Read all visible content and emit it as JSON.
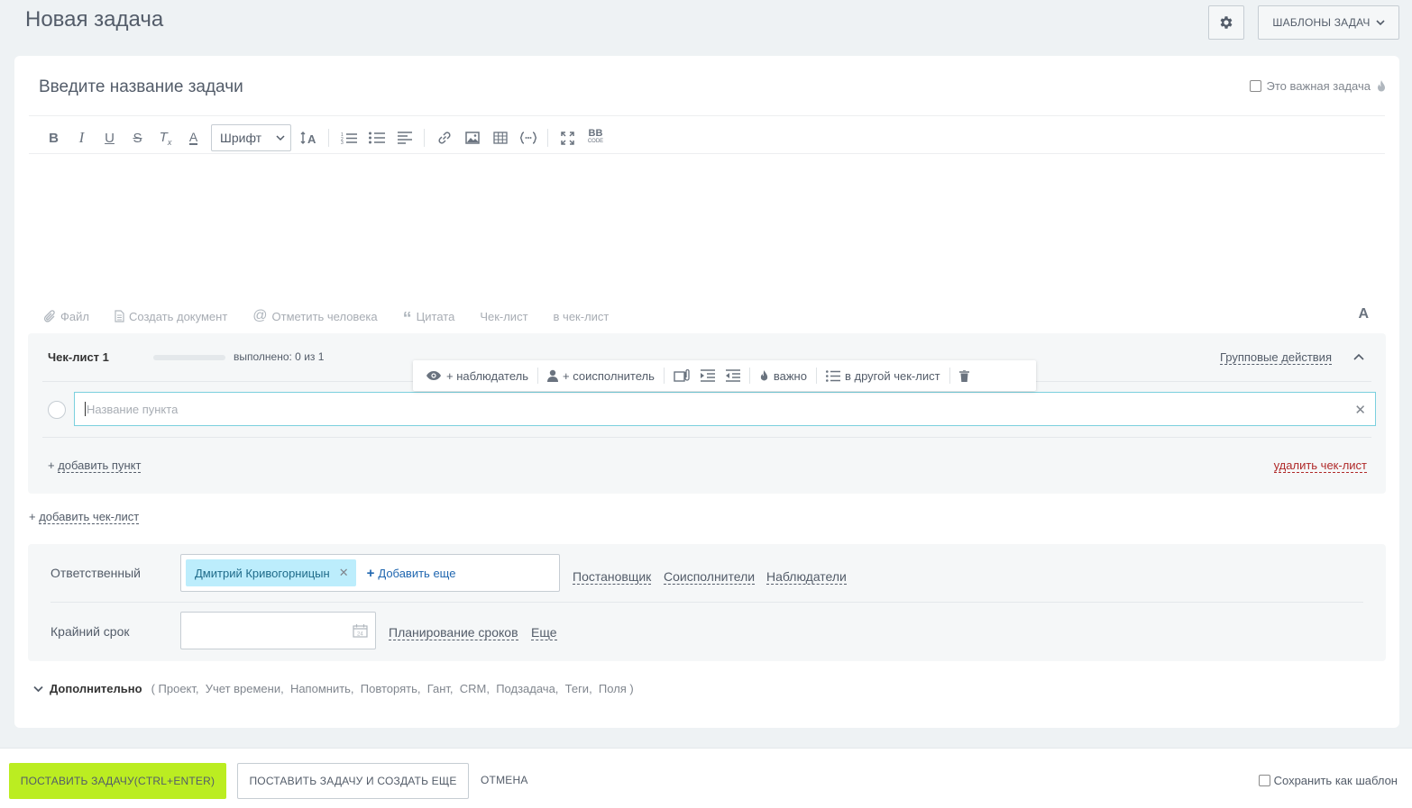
{
  "header": {
    "title": "Новая задача",
    "templates_label": "ШАБЛОНЫ ЗАДАЧ"
  },
  "task": {
    "title_placeholder": "Введите название задачи",
    "important_label": "Это важная задача"
  },
  "toolbar": {
    "font_label": "Шрифт",
    "bbcode_label": "BB",
    "bbcode_sub": "CODE"
  },
  "attach": {
    "file": "Файл",
    "create_doc": "Создать документ",
    "mention": "Отметить человека",
    "quote": "Цитата",
    "checklist": "Чек-лист",
    "to_checklist": "в чек-лист",
    "font_toggle": "A"
  },
  "checklist": {
    "title": "Чек-лист 1",
    "progress_text": "выполнено: 0 из 1",
    "progress": 0,
    "group_actions": "Групповые действия",
    "item_placeholder": "Название пункта",
    "add_item_plus": "+ ",
    "add_item": "добавить пункт",
    "delete": "удалить чек-лист",
    "popup": {
      "observer": "+ наблюдатель",
      "coexecutor": "+ соисполнитель",
      "important": "важно",
      "other_checklist": "в другой чек-лист"
    }
  },
  "add_checklist_plus": "+ ",
  "add_checklist": "добавить чек-лист",
  "people": {
    "responsible_label": "Ответственный",
    "responsible_name": "Дмитрий Кривогорницын",
    "add_more": "Добавить еще",
    "links": [
      "Постановщик",
      "Соисполнители",
      "Наблюдатели"
    ],
    "deadline_label": "Крайний срок",
    "planning": "Планирование сроков",
    "more": "Еще"
  },
  "extra": {
    "label": "Дополнительно",
    "items": "( Проект,  Учет времени,  Напомнить,  Повторять,  Гант,  CRM,  Подзадача,  Теги,  Поля )"
  },
  "footer": {
    "submit": "ПОСТАВИТЬ ЗАДАЧУ(CTRL+ENTER)",
    "submit_more": "ПОСТАВИТЬ ЗАДАЧУ И СОЗДАТЬ ЕЩЕ",
    "cancel": "ОТМЕНА",
    "save_template": "Сохранить как шаблон"
  },
  "colors": {
    "accent_green": "#bbed21",
    "chip_blue": "#bcedfc",
    "danger": "#b02a2a",
    "link_blue": "#2067b0"
  }
}
